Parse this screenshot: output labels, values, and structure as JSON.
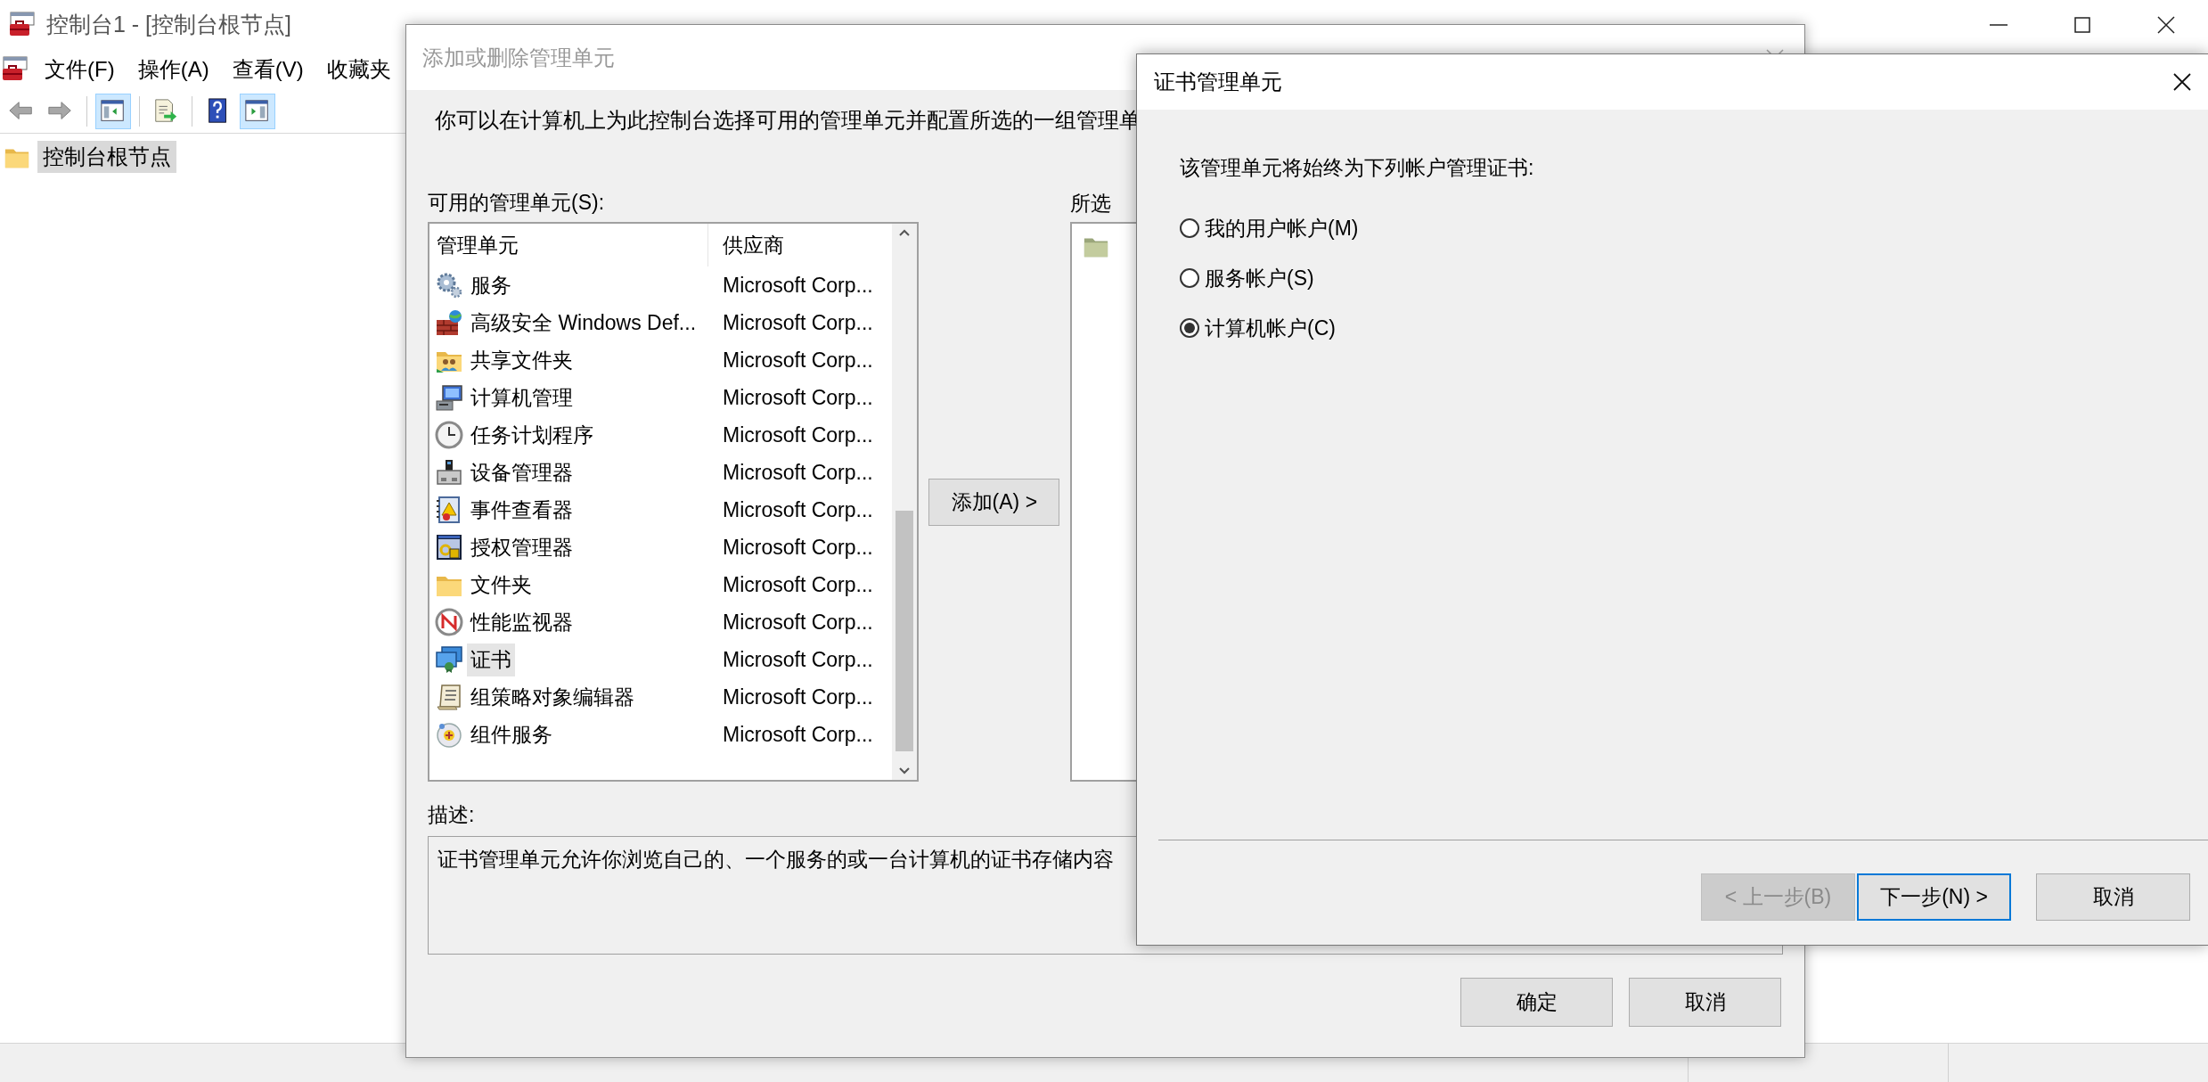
{
  "main_window": {
    "title": "控制台1 - [控制台根节点]",
    "menu": [
      "文件(F)",
      "操作(A)",
      "查看(V)",
      "收藏夹"
    ],
    "toolbar": [
      {
        "kind": "back",
        "on": false
      },
      {
        "kind": "forward",
        "on": false
      },
      {
        "kind": "tree-pane",
        "on": true
      },
      {
        "kind": "export",
        "on": false
      },
      {
        "kind": "help",
        "on": false
      },
      {
        "kind": "action-pane",
        "on": true
      }
    ],
    "tree": [
      {
        "label": "控制台根节点",
        "selected": true
      }
    ]
  },
  "add_remove_dialog": {
    "title": "添加或删除管理单元",
    "intro": "你可以在计算机上为此控制台选择可用的管理单元并配置所选的一组管理单",
    "available_label": "可用的管理单元(S):",
    "columns": [
      "管理单元",
      "供应商"
    ],
    "snapins": [
      {
        "name": "服务",
        "vendor": "Microsoft Corp...",
        "kind": "gears",
        "selected": false
      },
      {
        "name": "高级安全 Windows Def...",
        "vendor": "Microsoft Corp...",
        "kind": "firewall",
        "selected": false
      },
      {
        "name": "共享文件夹",
        "vendor": "Microsoft Corp...",
        "kind": "shared",
        "selected": false
      },
      {
        "name": "计算机管理",
        "vendor": "Microsoft Corp...",
        "kind": "computer",
        "selected": false
      },
      {
        "name": "任务计划程序",
        "vendor": "Microsoft Corp...",
        "kind": "clock",
        "selected": false
      },
      {
        "name": "设备管理器",
        "vendor": "Microsoft Corp...",
        "kind": "device",
        "selected": false
      },
      {
        "name": "事件查看器",
        "vendor": "Microsoft Corp...",
        "kind": "event",
        "selected": false
      },
      {
        "name": "授权管理器",
        "vendor": "Microsoft Corp...",
        "kind": "auth",
        "selected": false
      },
      {
        "name": "文件夹",
        "vendor": "Microsoft Corp...",
        "kind": "folder",
        "selected": false
      },
      {
        "name": "性能监视器",
        "vendor": "Microsoft Corp...",
        "kind": "perf",
        "selected": false
      },
      {
        "name": "证书",
        "vendor": "Microsoft Corp...",
        "kind": "cert",
        "selected": true
      },
      {
        "name": "组策略对象编辑器",
        "vendor": "Microsoft Corp...",
        "kind": "policy",
        "selected": false
      },
      {
        "name": "组件服务",
        "vendor": "Microsoft Corp...",
        "kind": "component",
        "selected": false
      }
    ],
    "add_button": "添加(A) >",
    "selected_label": "所选",
    "description_label": "描述:",
    "description": "证书管理单元允许你浏览自己的、一个服务的或一台计算机的证书存储内容",
    "buttons": [
      "确定",
      "取消"
    ]
  },
  "cert_dialog": {
    "title": "证书管理单元",
    "prompt": "该管理单元将始终为下列帐户管理证书:",
    "options": [
      {
        "label": "我的用户帐户(M)",
        "selected": false
      },
      {
        "label": "服务帐户(S)",
        "selected": false
      },
      {
        "label": "计算机帐户(C)",
        "selected": true
      }
    ],
    "buttons": [
      {
        "label": "< 上一步(B)",
        "disabled": true,
        "focused": false
      },
      {
        "label": "下一步(N) >",
        "disabled": false,
        "focused": true
      },
      {
        "label": "取消",
        "disabled": false,
        "focused": false
      }
    ]
  }
}
